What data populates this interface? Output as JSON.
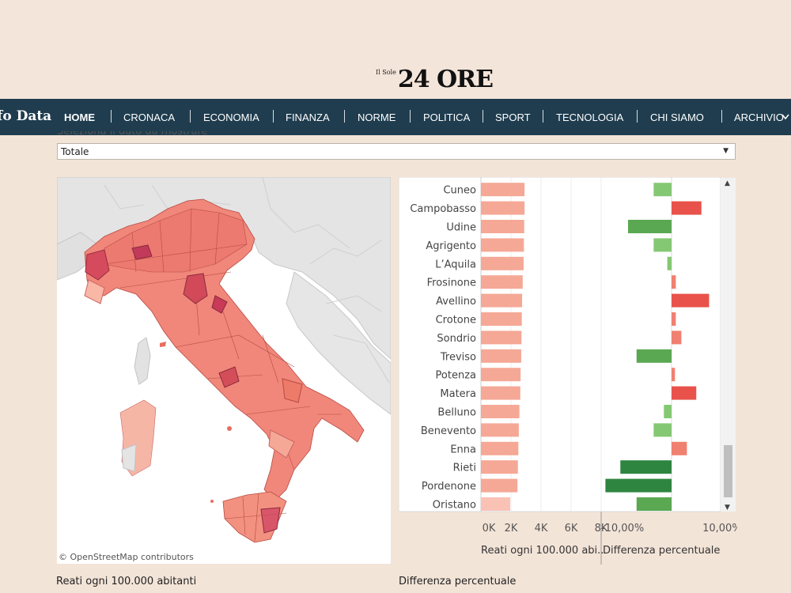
{
  "header": {
    "logo_small": "Il Sole",
    "logo_big": "24 ORE"
  },
  "nav": {
    "brand": "fo Data",
    "items": [
      "HOME",
      "CRONACA",
      "ECONOMIA",
      "FINANZA",
      "NORME",
      "POLITICA",
      "SPORT",
      "TECNOLOGIA",
      "CHI SIAMO",
      "ARCHIVIO"
    ],
    "more_icon": "chevron-down-icon"
  },
  "filter": {
    "label": "Seleziona il dato da mostrare",
    "selected": "Totale"
  },
  "map": {
    "credit": "© OpenStreetMap contributors",
    "legend_title": "Reati ogni 100.000 abitanti"
  },
  "chart_data": {
    "type": "bar",
    "categories": [
      "Cuneo",
      "Campobasso",
      "Udine",
      "Agrigento",
      "L’Aquila",
      "Frosinone",
      "Avellino",
      "Crotone",
      "Sondrio",
      "Treviso",
      "Potenza",
      "Matera",
      "Belluno",
      "Benevento",
      "Enna",
      "Rieti",
      "Pordenone",
      "Oristano"
    ],
    "series": [
      {
        "name": "Reati ogni 100.000 abi..",
        "values": [
          2900,
          2900,
          2880,
          2860,
          2840,
          2780,
          2740,
          2720,
          2700,
          2680,
          2640,
          2620,
          2560,
          2520,
          2490,
          2460,
          2430,
          1950
        ],
        "xlim": [
          0,
          8000
        ],
        "ticks": [
          "0K",
          "2K",
          "4K",
          "6K",
          "8K"
        ]
      },
      {
        "name": "Differenza percentuale",
        "values": [
          -4.2,
          7.0,
          -10.2,
          -4.2,
          -1.0,
          1.0,
          8.8,
          1.0,
          2.3,
          -8.2,
          0.8,
          5.8,
          -1.8,
          -4.2,
          3.6,
          -12.0,
          -15.5,
          -8.2
        ],
        "xlim": [
          -16.5,
          11.5
        ],
        "ticks": [
          "-10,00%",
          "10,00%"
        ],
        "colors": {
          "pos_high": "#e8524a",
          "pos_low": "#f08070",
          "neg_high": "#2e8540",
          "neg_mid": "#5aa852",
          "neg_low": "#85c873"
        }
      }
    ],
    "bar_color": "#f5a896",
    "last_bar_color": "#f9c2b5"
  },
  "footer": {
    "left_label": "Reati ogni 100.000 abitanti",
    "right_label": "Differenza percentuale"
  }
}
